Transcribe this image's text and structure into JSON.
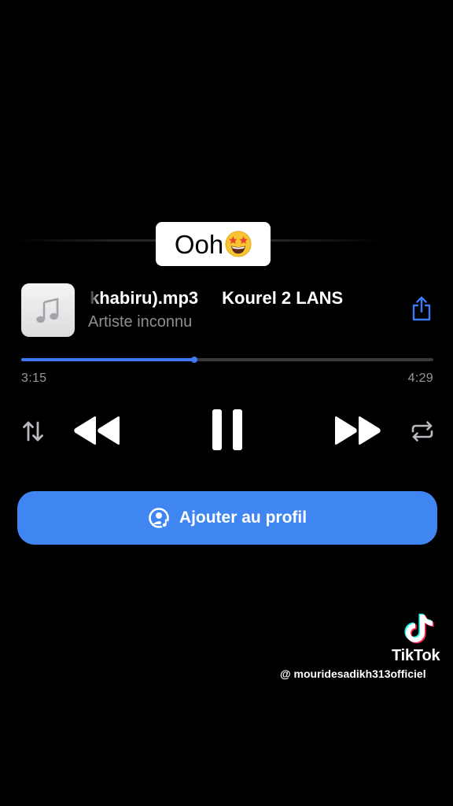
{
  "caption": {
    "text": "Ooh",
    "emoji": "star-struck-emoji"
  },
  "track": {
    "artwork_icon": "music-note-icon",
    "title_visible": "khabiru).mp3",
    "title_next": "Kourel 2 LANS",
    "artist": "Artiste inconnu",
    "share_icon": "share-icon"
  },
  "progress": {
    "elapsed": "3:15",
    "total": "4:29",
    "fraction": 0.42
  },
  "controls": {
    "shuffle_icon": "reorder-arrows-icon",
    "rewind_icon": "rewind-icon",
    "pause_icon": "pause-icon",
    "forward_icon": "fast-forward-icon",
    "repeat_icon": "repeat-icon"
  },
  "add_profile": {
    "label": "Ajouter au profil",
    "icon": "profile-music-icon"
  },
  "watermark": {
    "brand": "TikTok",
    "handle": "@ mouridesadikh313officiel"
  },
  "colors": {
    "accent": "#3d7bf6",
    "button_bg": "#3f86f3",
    "background": "#000000",
    "secondary_text": "#8e8e93"
  }
}
